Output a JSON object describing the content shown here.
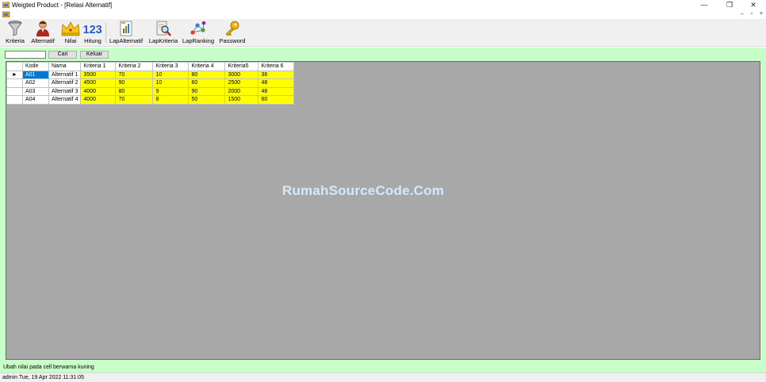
{
  "window": {
    "title": "Weigted Product - [Relasi Alternatif]",
    "minimize": "—",
    "restore": "❐",
    "close": "✕"
  },
  "mdi": {
    "minimize": "–",
    "restore": "▫",
    "close": "×"
  },
  "toolbar": {
    "items": [
      {
        "label": "Kriteria",
        "icon": "funnel-icon"
      },
      {
        "label": "Alternatif",
        "icon": "person-icon"
      },
      {
        "label": "Nilai",
        "icon": "crown-icon"
      },
      {
        "label": "Hitung",
        "icon": "numbers-123-icon",
        "glyph": "123"
      },
      {
        "label": "LapAlternatif",
        "icon": "report-chart-icon"
      },
      {
        "label": "LapKriteria",
        "icon": "report-search-icon"
      },
      {
        "label": "LapRanking",
        "icon": "ranking-network-icon"
      },
      {
        "label": "Password",
        "icon": "keys-icon"
      }
    ]
  },
  "search": {
    "value": "",
    "placeholder": ""
  },
  "buttons": {
    "cari": "Cari",
    "keluar": "Keluar"
  },
  "grid": {
    "row_indicator": "►",
    "columns": [
      "Kode",
      "Nama",
      "Kriteria 1",
      "Kriteria 2",
      "Kriteria 3",
      "Kriteria 4",
      "Kriteria5",
      "Kriteria 6"
    ],
    "rows": [
      [
        "A01",
        "Alternatif 1",
        "3500",
        "70",
        "10",
        "80",
        "3000",
        "36"
      ],
      [
        "A02",
        "Alternatif 2",
        "4500",
        "90",
        "10",
        "60",
        "2500",
        "48"
      ],
      [
        "A03",
        "Alternatif 3",
        "4000",
        "80",
        "9",
        "90",
        "2000",
        "48"
      ],
      [
        "A04",
        "Alternatif 4",
        "4000",
        "70",
        "8",
        "50",
        "1500",
        "60"
      ]
    ]
  },
  "watermark": "RumahSourceCode.Com",
  "hint": "Ubah nilai pada cell berwarna kuning",
  "status": "admin Tue, 19 Apr 2022 11:31:05",
  "colors": {
    "editable_cell": "#ffff00",
    "selected_cell": "#0078d7",
    "workspace_bg": "#c8ffc8",
    "grid_bg": "#a8a8a8"
  }
}
